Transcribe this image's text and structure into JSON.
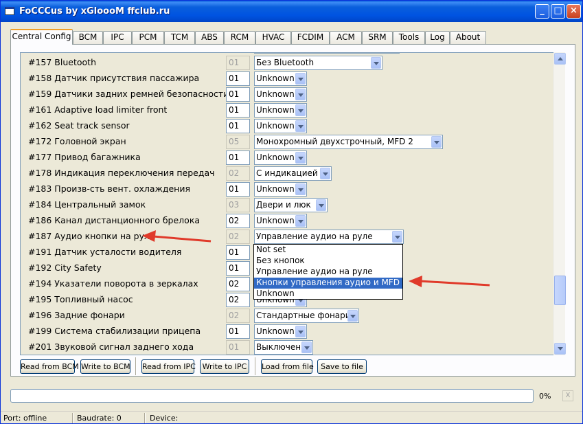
{
  "window": {
    "title": "FoCCCus by xGloooM ffclub.ru"
  },
  "tabs": [
    "Central Config",
    "BCM",
    "IPC",
    "PCM",
    "TCM",
    "ABS",
    "RCM",
    "HVAC",
    "FCDIM",
    "ACM",
    "SRM",
    "Tools",
    "Log",
    "About"
  ],
  "rows": [
    {
      "label": "#157 Bluetooth",
      "code": "01",
      "code_disabled": true,
      "value": "Без Bluetooth"
    },
    {
      "label": "#158 Датчик присутствия пассажира",
      "code": "01",
      "code_disabled": false,
      "value": "Unknown"
    },
    {
      "label": "#159 Датчики задних ремней безопасности",
      "code": "01",
      "code_disabled": false,
      "value": "Unknown"
    },
    {
      "label": "#161 Adaptive load limiter front",
      "code": "01",
      "code_disabled": false,
      "value": "Unknown"
    },
    {
      "label": "#162 Seat track sensor",
      "code": "01",
      "code_disabled": false,
      "value": "Unknown"
    },
    {
      "label": "#172 Головной экран",
      "code": "05",
      "code_disabled": true,
      "value": "Монохромный двухстрочный, MFD 2"
    },
    {
      "label": "#177 Привод багажника",
      "code": "01",
      "code_disabled": false,
      "value": "Unknown"
    },
    {
      "label": "#178 Индикация переключения передач",
      "code": "02",
      "code_disabled": true,
      "value": "С индикацией"
    },
    {
      "label": "#183 Произв-сть вент. охлаждения",
      "code": "01",
      "code_disabled": false,
      "value": "Unknown"
    },
    {
      "label": "#184 Центральный замок",
      "code": "03",
      "code_disabled": true,
      "value": "Двери и люк"
    },
    {
      "label": "#186 Канал дистанционного брелока",
      "code": "02",
      "code_disabled": false,
      "value": "Unknown"
    },
    {
      "label": "#187 Аудио кнопки на руле",
      "code": "02",
      "code_disabled": true,
      "value": "Управление аудио на руле"
    },
    {
      "label": "#191 Датчик усталости водителя",
      "code": "01",
      "code_disabled": false,
      "value": "Unknown"
    },
    {
      "label": "#192 City Safety",
      "code": "01",
      "code_disabled": false,
      "value": "Unknown"
    },
    {
      "label": "#194 Указатели поворота в зеркалах",
      "code": "02",
      "code_disabled": false,
      "value": "Unknown"
    },
    {
      "label": "#195 Топливный насос",
      "code": "02",
      "code_disabled": false,
      "value": "Unknown"
    },
    {
      "label": "#196 Задние фонари",
      "code": "02",
      "code_disabled": true,
      "value": "Стандартные фонари"
    },
    {
      "label": "#199 Система стабилизации прицепа",
      "code": "01",
      "code_disabled": false,
      "value": "Unknown"
    },
    {
      "label": "#201 Звуковой сигнал заднего хода",
      "code": "01",
      "code_disabled": true,
      "value": "Выключен"
    }
  ],
  "dropdown": {
    "options": [
      "Not set",
      "Без кнопок",
      "Управление аудио на руле",
      "Кнопки управления аудио и MFD",
      "Unknown"
    ],
    "highlighted_index": 3
  },
  "buttons": {
    "read_bcm": "Read from BCM",
    "write_bcm": "Write to BCM",
    "read_ipc": "Read from IPC",
    "write_ipc": "Write to IPC",
    "load_file": "Load from file",
    "save_file": "Save to file"
  },
  "progress": {
    "percent_text": "0%",
    "value": 0
  },
  "status": {
    "port": "Port: offline",
    "baudrate": "Baudrate: 0",
    "device": "Device:"
  },
  "colors": {
    "title_bar": "#0053e1",
    "selection": "#316ac5",
    "annotation_arrow": "#e03a2a"
  }
}
